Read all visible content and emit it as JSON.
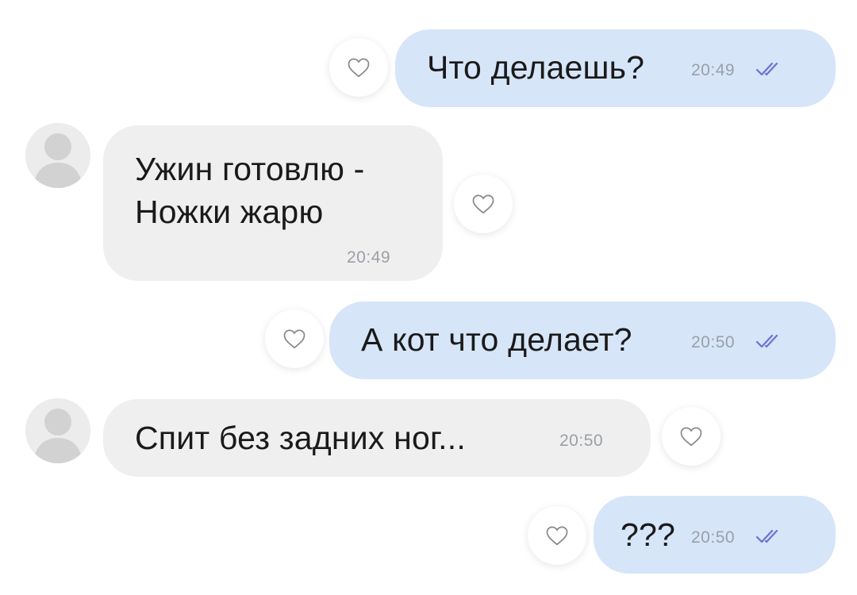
{
  "messages": [
    {
      "direction": "outgoing",
      "text": "Что делаешь?",
      "time": "20:49",
      "status_icon": "double-check-icon"
    },
    {
      "direction": "incoming",
      "text_line1": "Ужин готовлю -",
      "text_line2": "Ножки жарю",
      "time": "20:49"
    },
    {
      "direction": "outgoing",
      "text": "А кот что делает?",
      "time": "20:50",
      "status_icon": "double-check-icon"
    },
    {
      "direction": "incoming",
      "text": "Спит без задних ног...",
      "time": "20:50"
    },
    {
      "direction": "outgoing",
      "text": "???",
      "time": "20:50",
      "status_icon": "double-check-icon"
    }
  ],
  "colors": {
    "outgoing_bubble": "#d6e5f8",
    "incoming_bubble": "#efefef",
    "read_check": "#6f6fd8",
    "time_text": "#9aa0a6"
  },
  "icons": {
    "reaction": "heart-outline-icon",
    "avatar": "default-avatar-icon"
  }
}
